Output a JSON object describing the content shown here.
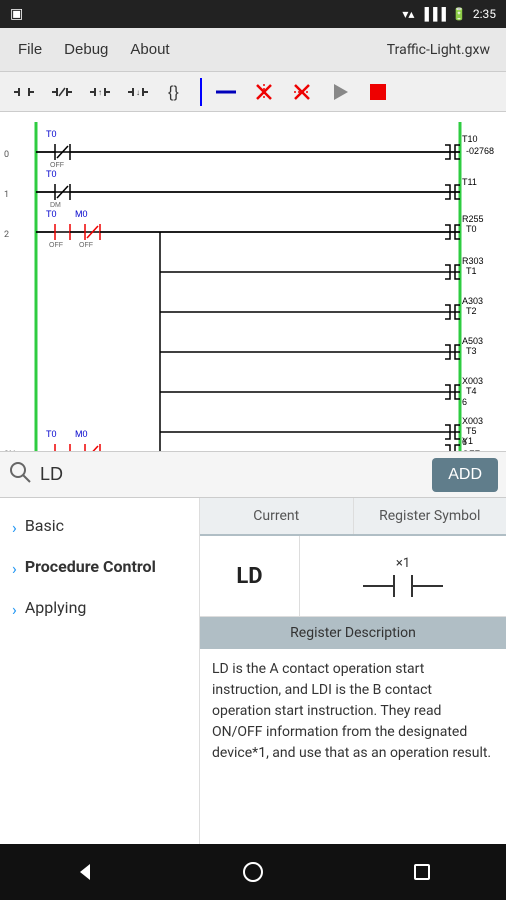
{
  "statusBar": {
    "time": "2:35",
    "battery": "100",
    "signal": "full"
  },
  "menuBar": {
    "items": [
      "File",
      "Debug",
      "About"
    ],
    "fileTitle": "Traffic-Light.gxw"
  },
  "toolbar": {
    "tools": [
      {
        "name": "normally-open-contact",
        "symbol": "⊣⊢"
      },
      {
        "name": "normally-closed-contact",
        "symbol": "⊣/⊢"
      },
      {
        "name": "positive-transition",
        "symbol": "⊣↑⊢"
      },
      {
        "name": "negative-transition",
        "symbol": "⊣↓⊢"
      },
      {
        "name": "application-instruction",
        "symbol": "{}"
      },
      {
        "name": "vertical-line",
        "symbol": "|"
      },
      {
        "name": "horizontal-line",
        "symbol": "—"
      },
      {
        "name": "delete-vertical",
        "symbol": "✕"
      },
      {
        "name": "delete-horizontal",
        "symbol": "✕"
      },
      {
        "name": "run",
        "symbol": "▶"
      },
      {
        "name": "stop",
        "symbol": "■"
      }
    ]
  },
  "search": {
    "placeholder": "LD",
    "value": "LD",
    "addLabel": "ADD"
  },
  "sidebar": {
    "items": [
      {
        "label": "Basic",
        "active": false
      },
      {
        "label": "Procedure Control",
        "active": true
      },
      {
        "label": "Applying",
        "active": false
      }
    ]
  },
  "registerPanel": {
    "columns": [
      "Current",
      "Register Symbol"
    ],
    "currentValue": "LD",
    "symbolLabel": "×1",
    "descriptionHeader": "Register Description",
    "descriptionText": "LD is the A contact operation start instruction, and LDI is the B contact operation start instruction. They read ON/OFF information from the designated device*1, and use that as an operation result."
  }
}
